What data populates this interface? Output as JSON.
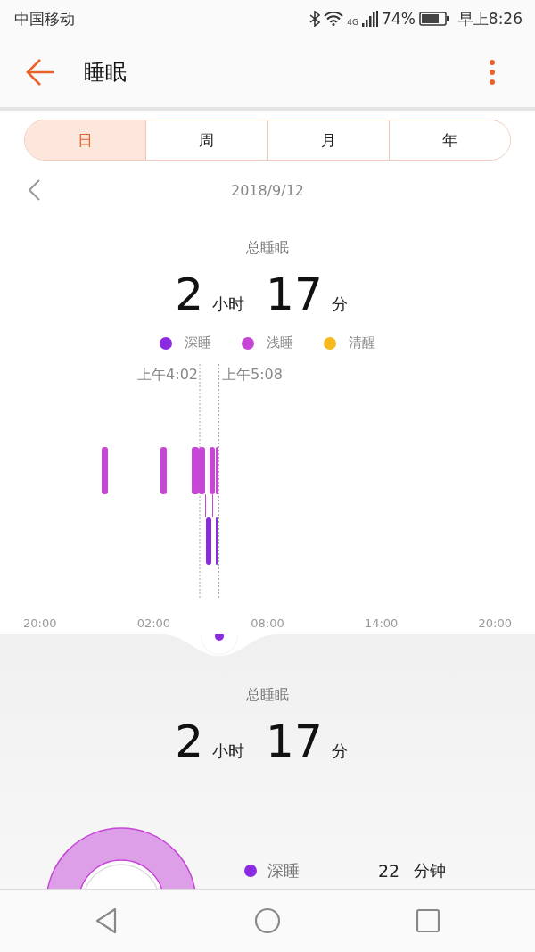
{
  "status_bar": {
    "carrier": "中国移动",
    "network": "4G",
    "battery": "74%",
    "time": "早上8:26"
  },
  "app_bar": {
    "title": "睡眠"
  },
  "tabs": [
    {
      "label": "日",
      "selected": true
    },
    {
      "label": "周",
      "selected": false
    },
    {
      "label": "月",
      "selected": false
    },
    {
      "label": "年",
      "selected": false
    }
  ],
  "date": "2018/9/12",
  "summary": {
    "title": "总睡眠",
    "hours": "2",
    "hours_unit": "小时",
    "minutes": "17",
    "minutes_unit": "分"
  },
  "legend": [
    {
      "label": "深睡",
      "color": "#8b2be0"
    },
    {
      "label": "浅睡",
      "color": "#c646d6"
    },
    {
      "label": "清醒",
      "color": "#f6b91e"
    }
  ],
  "markers": {
    "start": "上午4:02",
    "end": "上午5:08"
  },
  "x_axis": [
    "20:00",
    "02:00",
    "08:00",
    "14:00",
    "20:00"
  ],
  "detail": {
    "title": "总睡眠",
    "hours": "2",
    "hours_unit": "小时",
    "minutes": "17",
    "minutes_unit": "分",
    "breakdown": [
      {
        "label": "深睡",
        "value": "22",
        "unit": "分钟",
        "color": "#8b2be0"
      }
    ]
  }
}
